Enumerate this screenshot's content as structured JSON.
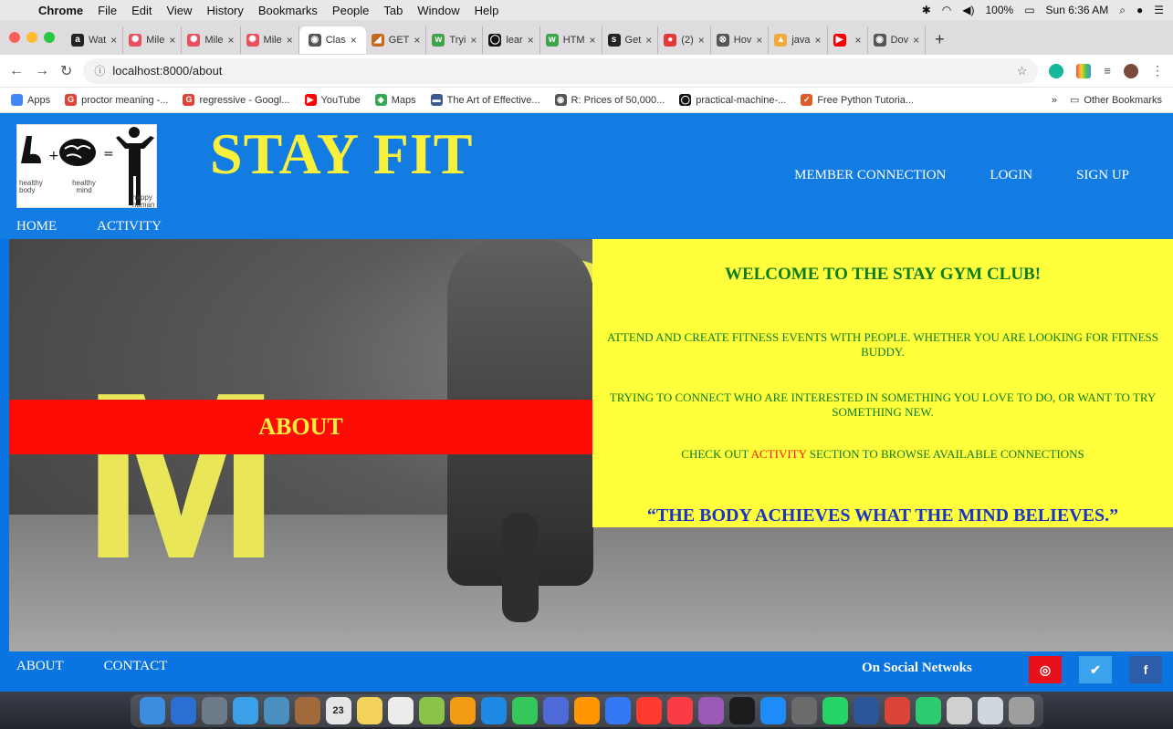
{
  "menubar": {
    "app": "Chrome",
    "items": [
      "File",
      "Edit",
      "View",
      "History",
      "Bookmarks",
      "People",
      "Tab",
      "Window",
      "Help"
    ],
    "battery": "100%",
    "clock": "Sun 6:36 AM"
  },
  "tabs": [
    {
      "label": "Wat",
      "icon_color": "#222222",
      "glyph": "a"
    },
    {
      "label": "Mile",
      "icon_color": "#e8505b",
      "glyph": "✺"
    },
    {
      "label": "Mile",
      "icon_color": "#e8505b",
      "glyph": "✺"
    },
    {
      "label": "Mile",
      "icon_color": "#e8505b",
      "glyph": "✺"
    },
    {
      "label": "Clas",
      "icon_color": "#555555",
      "glyph": "◉",
      "active": true
    },
    {
      "label": "GET",
      "icon_color": "#c46b1b",
      "glyph": "◢"
    },
    {
      "label": "Tryi",
      "icon_color": "#3fa34d",
      "glyph": "w"
    },
    {
      "label": "lear",
      "icon_color": "#111111",
      "glyph": "◯"
    },
    {
      "label": "HTM",
      "icon_color": "#3fa34d",
      "glyph": "w"
    },
    {
      "label": "Get",
      "icon_color": "#222222",
      "glyph": "s"
    },
    {
      "label": "(2)",
      "icon_color": "#e03a3a",
      "glyph": "●"
    },
    {
      "label": "Hov",
      "icon_color": "#555555",
      "glyph": "⊗"
    },
    {
      "label": "java",
      "icon_color": "#f2a93b",
      "glyph": "▲"
    },
    {
      "label": "",
      "icon_color": "#ff0000",
      "glyph": "▶"
    },
    {
      "label": "Dov",
      "icon_color": "#555555",
      "glyph": "◉"
    }
  ],
  "toolbar": {
    "url": "localhost:8000/about"
  },
  "bookmarks": [
    {
      "label": "Apps",
      "icon_color": "#4285f4"
    },
    {
      "label": "proctor meaning -...",
      "icon_color": "#db4437",
      "glyph": "G"
    },
    {
      "label": "regressive - Googl...",
      "icon_color": "#db4437",
      "glyph": "G"
    },
    {
      "label": "YouTube",
      "icon_color": "#ff0000",
      "glyph": "▶"
    },
    {
      "label": "Maps",
      "icon_color": "#34a853",
      "glyph": "◆"
    },
    {
      "label": "The Art of Effective...",
      "icon_color": "#3a5a8c",
      "glyph": "▬"
    },
    {
      "label": "R: Prices of 50,000...",
      "icon_color": "#555555",
      "glyph": "◉"
    },
    {
      "label": "practical-machine-...",
      "icon_color": "#111111",
      "glyph": "◯"
    },
    {
      "label": "Free Python Tutoria...",
      "icon_color": "#e05a2a",
      "glyph": "✓"
    }
  ],
  "bookmarks_other": "Other Bookmarks",
  "site": {
    "logo_captions": [
      "healthy body",
      "healthy mind",
      "happy human"
    ],
    "brand": "STAY FIT",
    "topnav": [
      "MEMBER CONNECTION",
      "LOGIN",
      "SIGN UP"
    ],
    "subnav": [
      "HOME",
      "ACTIVITY"
    ],
    "about_band": "ABOUT",
    "welcome": {
      "title": "WELCOME TO THE STAY GYM CLUB!",
      "para1": "ATTEND AND CREATE FITNESS EVENTS WITH PEOPLE. WHETHER YOU ARE LOOKING FOR FITNESS BUDDY.",
      "para2": "TRYING TO CONNECT WHO ARE INTERESTED IN SOMETHING YOU LOVE TO DO, OR WANT TO TRY SOMETHING NEW.",
      "para3_pre": "CHECK OUT ",
      "para3_hl": "ACTIVITY",
      "para3_post": " SECTION TO BROWSE AVAILABLE CONNECTIONS",
      "quote": "“THE BODY ACHIEVES WHAT THE MIND BELIEVES.”"
    },
    "footer": {
      "links": [
        "ABOUT",
        "CONTACT"
      ],
      "social_label": "On Social Netwoks",
      "social": [
        {
          "name": "instagram",
          "glyph": "◎",
          "color": "#e8101a"
        },
        {
          "name": "twitter",
          "glyph": "✔",
          "color": "#3aa3ec"
        },
        {
          "name": "facebook",
          "glyph": "f",
          "color": "#2d5da8"
        }
      ]
    }
  },
  "dock": {
    "calendar_day": "23"
  }
}
